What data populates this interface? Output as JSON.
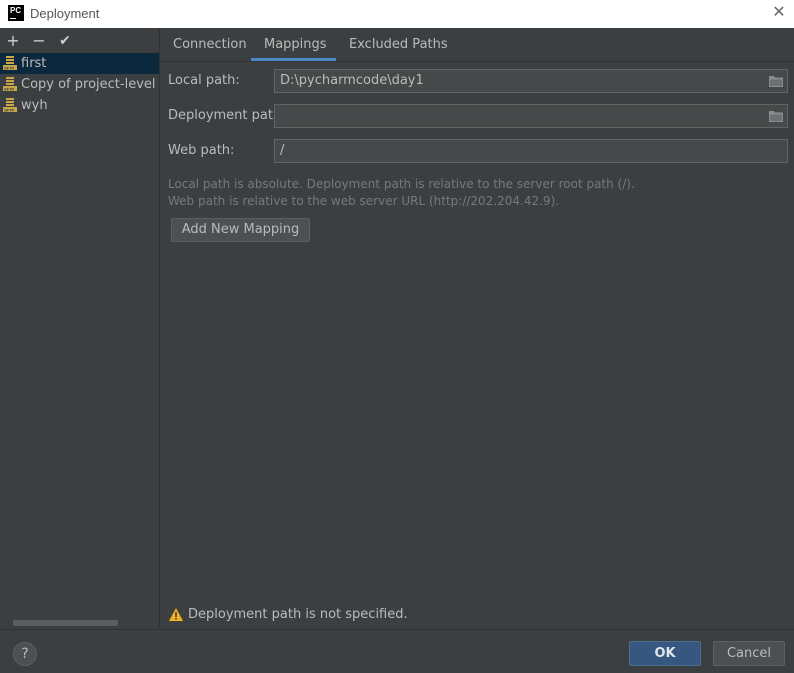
{
  "window": {
    "title": "Deployment",
    "logo_text": "PC"
  },
  "left_toolbar": {
    "add_icon": "+",
    "remove_icon": "−",
    "apply_icon": "✔"
  },
  "servers": [
    {
      "label": "first",
      "selected": true
    },
    {
      "label": "Copy of project-level se",
      "selected": false
    },
    {
      "label": "wyh",
      "selected": false
    }
  ],
  "tabs": [
    {
      "label": "Connection",
      "active": false
    },
    {
      "label": "Mappings",
      "active": true
    },
    {
      "label": "Excluded Paths",
      "active": false
    }
  ],
  "form": {
    "local_path_label": "Local path:",
    "local_path_value": "D:\\pycharmcode\\day1",
    "deployment_path_label": "Deployment path:",
    "deployment_path_value": "",
    "web_path_label": "Web path:",
    "web_path_value": "/",
    "hint_line1": "Local path is absolute. Deployment path is relative to the server root path (/).",
    "hint_line2": "Web path is relative to the web server URL (http://202.204.42.9).",
    "add_mapping_label": "Add New Mapping"
  },
  "warning": {
    "text": "Deployment path is not specified.",
    "color": "#f2b024"
  },
  "footer": {
    "help_label": "?",
    "ok_label": "OK",
    "cancel_label": "Cancel"
  },
  "colors": {
    "accent": "#4a88c7",
    "primary_button": "#365880",
    "selection": "#0d293e"
  }
}
